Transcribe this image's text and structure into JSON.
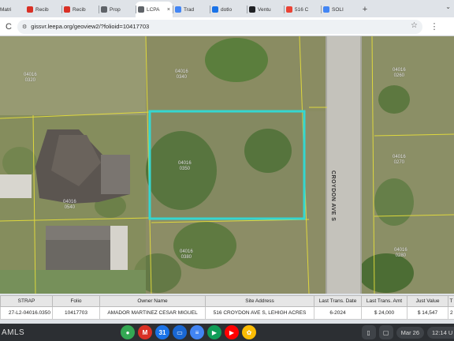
{
  "browser": {
    "first_tab_title": "Matri",
    "tabs": [
      {
        "title": "Recib",
        "icon": "gmail-icon",
        "color": "#d93025",
        "active": false
      },
      {
        "title": "Recib",
        "icon": "gmail-icon",
        "color": "#d93025",
        "active": false
      },
      {
        "title": "Prop",
        "icon": "globe-icon",
        "color": "#5f6368",
        "active": false
      },
      {
        "title": "LCPA",
        "icon": "globe-icon",
        "color": "#5f6368",
        "active": true
      },
      {
        "title": "Trad",
        "icon": "translate-icon",
        "color": "#4285f4",
        "active": false
      },
      {
        "title": "dotlo",
        "icon": "dotloop-icon",
        "color": "#1a73e8",
        "active": false
      },
      {
        "title": "Ventu",
        "icon": "vent-icon",
        "color": "#202124",
        "active": false
      },
      {
        "title": "516 C",
        "icon": "maps-pin-icon",
        "color": "#ea4335",
        "active": false
      },
      {
        "title": "SOLI",
        "icon": "google-icon",
        "color": "#4285f4",
        "active": false
      }
    ],
    "url": "gissvr.leepa.org/geoview2/?folioid=10417703",
    "new_tab_symbol": "+",
    "reload_symbol": "C",
    "star_symbol": "☆",
    "menu_symbol": "⋮",
    "tab_search_symbol": "⌄"
  },
  "map": {
    "road_name": "CROYDON AVE S",
    "highlight_color": "#35d6d0",
    "parcel_labels": [
      {
        "line1": "04016",
        "line2": "0320"
      },
      {
        "line1": "04016",
        "line2": "0340"
      },
      {
        "line1": "04016",
        "line2": "0260"
      },
      {
        "line1": "04016",
        "line2": "0350"
      },
      {
        "line1": "04016",
        "line2": "0270"
      },
      {
        "line1": "04016",
        "line2": "0540"
      },
      {
        "line1": "04016",
        "line2": "0380"
      },
      {
        "line1": "04016",
        "line2": "0280"
      }
    ]
  },
  "table": {
    "headers": [
      "STRAP",
      "Folio",
      "Owner Name",
      "Site Address",
      "Last Trans. Date",
      "Last Trans. Amt",
      "Just Value",
      "T"
    ],
    "row": [
      "27-L2-04016.0350",
      "10417703",
      "AMADOR MARTINEZ CESAR MIGUEL",
      "516 CROYDON AVE S, LEHIGH ACRES",
      "6-2024",
      "$ 24,000",
      "$ 14,547",
      "2"
    ]
  },
  "taskbar": {
    "left_text": "AMLS",
    "apps": [
      {
        "name": "chrome-icon",
        "glyph": "●",
        "color": "#34a853"
      },
      {
        "name": "gmail-app-icon",
        "glyph": "M",
        "color": "#d93025"
      },
      {
        "name": "calendar-app-icon",
        "glyph": "31",
        "color": "#1a73e8"
      },
      {
        "name": "files-app-icon",
        "glyph": "▭",
        "color": "#1967d2"
      },
      {
        "name": "docs-app-icon",
        "glyph": "≡",
        "color": "#4285f4"
      },
      {
        "name": "play-store-icon",
        "glyph": "▶",
        "color": "#0f9d58"
      },
      {
        "name": "youtube-icon",
        "glyph": "▶",
        "color": "#ff0000"
      },
      {
        "name": "photos-app-icon",
        "glyph": "✿",
        "color": "#fbbc04"
      }
    ],
    "date": "Mar 26",
    "time": "12:14 U"
  }
}
